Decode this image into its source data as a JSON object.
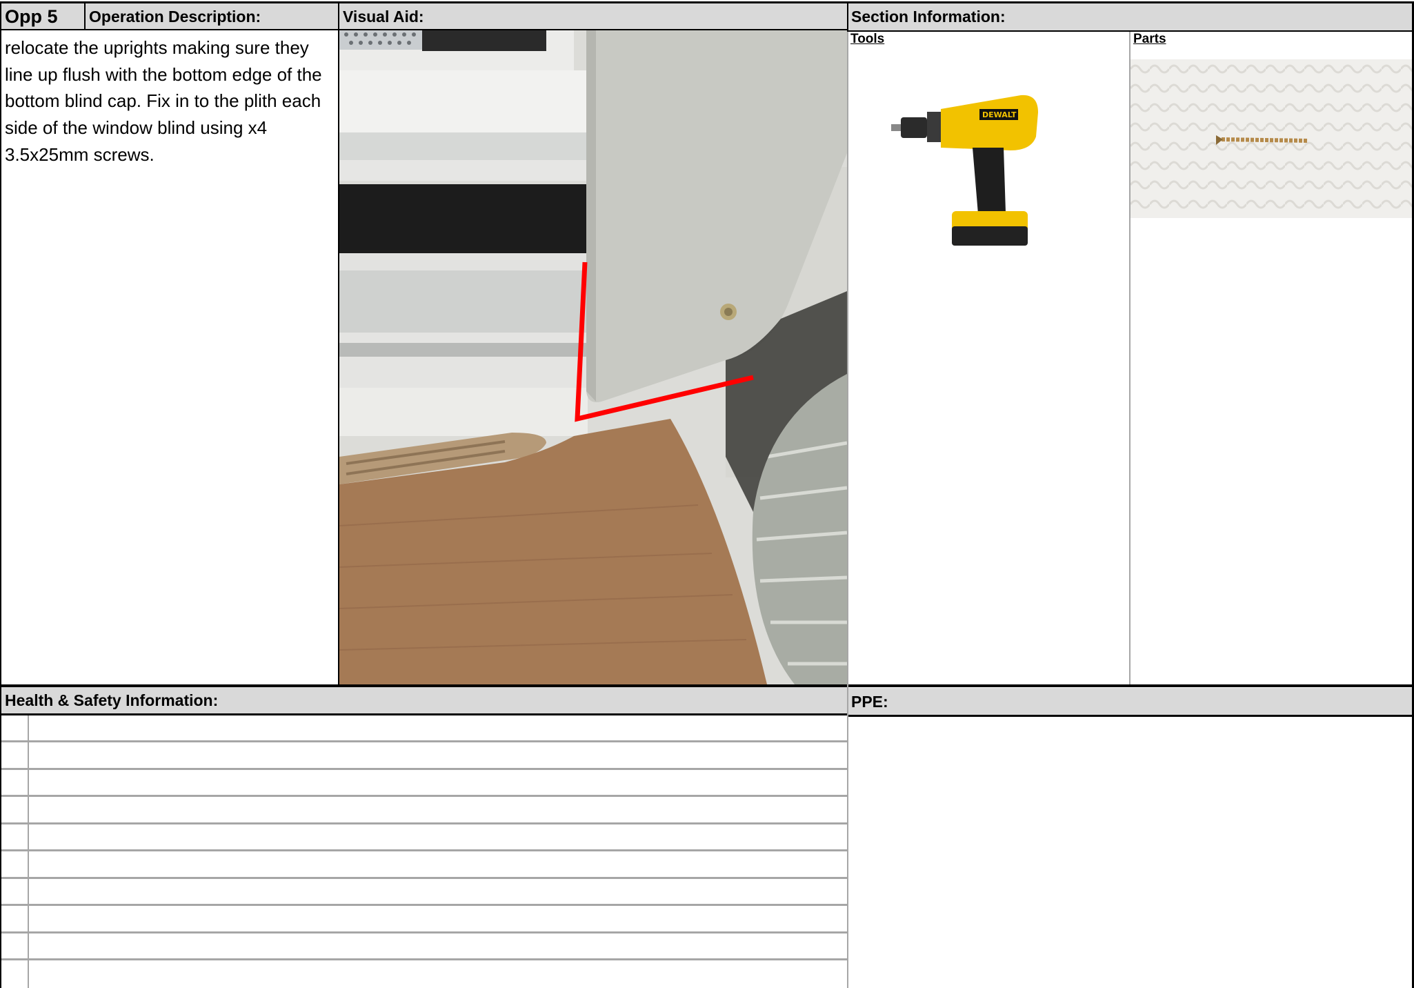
{
  "header": {
    "opp_label": "Opp 5",
    "operation_description_label": "Operation Description:",
    "visual_aid_label": "Visual Aid:",
    "section_information_label": "Section Information:"
  },
  "operation": {
    "description": "relocate the uprights making sure they line up flush with the bottom edge of the bottom blind cap. Fix in to the plith each side of the window blind using x4 3.5x25mm screws."
  },
  "visual_aid": {
    "photo": "blind-upright-installation-photo",
    "annotation_color": "#ff0000"
  },
  "section_information": {
    "tools_label": "Tools ",
    "parts_label": "Parts",
    "tool_image": "cordless-drill-photo",
    "tool_brand": "DEWALT",
    "part_image": "screw-photo"
  },
  "health_safety": {
    "label": "Health & Safety Information:",
    "rows": [
      "",
      "",
      "",
      "",
      "",
      "",
      "",
      "",
      "",
      ""
    ]
  },
  "ppe": {
    "label": "PPE:"
  },
  "colors": {
    "header_bg": "#d9d9d9",
    "grid_line": "#a6a6a6",
    "border": "#000000"
  }
}
